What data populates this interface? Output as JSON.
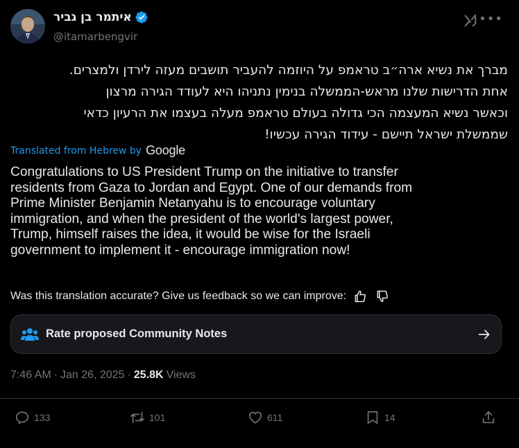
{
  "author": {
    "display_name": "איתמר בן גביר",
    "handle": "@itamarbengvir",
    "verified": true
  },
  "header_icons": [
    "grok-icon",
    "more-icon"
  ],
  "tweet": {
    "hebrew_lines": [
      "מברך את נשיא ארה״ב טראמפ על היוזמה להעביר תושבים מעזה לירדן ולמצרים.",
      "אחת הדרישות שלנו מראש-הממשלה בנימין נתניהו היא לעודד הגירה מרצון",
      "וכאשר נשיא המעצמה הכי גדולה בעולם טראמפ מעלה בעצמו את הרעיון כדאי",
      "שממשלת ישראל תיישם - עידוד הגירה עכשיו!"
    ],
    "translated_label": "Translated from Hebrew by",
    "translator": "Google",
    "english_lines": [
      "Congratulations to US President Trump on the initiative to transfer",
      "residents from Gaza to Jordan and Egypt. One of our demands from",
      "Prime Minister Benjamin Netanyahu is to encourage voluntary",
      "immigration, and when the president of the world's largest power,",
      "Trump, himself raises the idea, it would be wise for the Israeli",
      "government to implement it - encourage immigration now!"
    ],
    "feedback_prompt": "Was this translation accurate? Give us feedback so we can improve:"
  },
  "community_notes": {
    "label": "Rate proposed Community Notes"
  },
  "meta": {
    "time": "7:46 AM",
    "separator": "·",
    "date": "Jan 26, 2025",
    "separator2": "·",
    "views_count": "25.8K",
    "views_label": "Views"
  },
  "actions": {
    "replies": "133",
    "reposts": "101",
    "likes": "611",
    "bookmarks": "14"
  },
  "colors": {
    "background": "#000000",
    "text": "#e7e9ea",
    "secondary": "#71767b",
    "accent": "#1d9bf0",
    "border": "#2f3336"
  }
}
